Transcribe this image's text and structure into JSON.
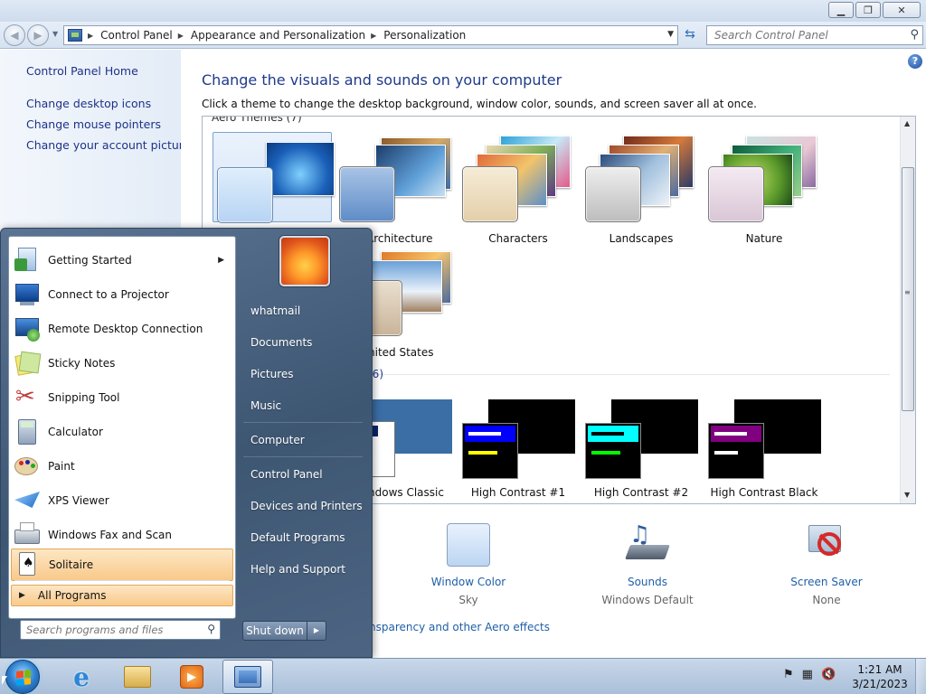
{
  "window": {
    "minimize": "▁",
    "maximize": "❐",
    "close": "✕"
  },
  "address": {
    "crumbs": [
      "Control Panel",
      "Appearance and Personalization",
      "Personalization"
    ],
    "search_placeholder": "Search Control Panel"
  },
  "left_pane": {
    "links": [
      "Control Panel Home",
      "Change desktop icons",
      "Change mouse pointers",
      "Change your account picture"
    ]
  },
  "main": {
    "heading": "Change the visuals and sounds on your computer",
    "subtext": "Click a theme to change the desktop background, window color, sounds, and screen saver all at once.",
    "aero_group_label": "Aero Themes (7)",
    "basic_group_label": "(6)",
    "themes": [
      "Architecture",
      "Characters",
      "Landscapes",
      "Nature",
      "nited States"
    ],
    "basic_themes": [
      "ndows Classic",
      "High Contrast #1",
      "High Contrast #2",
      "High Contrast Black"
    ],
    "settings": [
      {
        "title": "Window Color",
        "subtitle": "Sky"
      },
      {
        "title": "Sounds",
        "subtitle": "Windows Default"
      },
      {
        "title": "Screen Saver",
        "subtitle": "None"
      }
    ],
    "aero_link": "nsparency and other Aero effects"
  },
  "start_menu": {
    "programs": [
      "Getting Started",
      "Connect to a Projector",
      "Remote Desktop Connection",
      "Sticky Notes",
      "Snipping Tool",
      "Calculator",
      "Paint",
      "XPS Viewer",
      "Windows Fax and Scan",
      "Solitaire"
    ],
    "all_programs": "All Programs",
    "search_placeholder": "Search programs and files",
    "right_links": [
      "whatmail",
      "Documents",
      "Pictures",
      "Music",
      "Computer",
      "Control Panel",
      "Devices and Printers",
      "Default Programs",
      "Help and Support"
    ],
    "shutdown": "Shut down"
  },
  "taskbar": {
    "time": "1:21 AM",
    "date": "3/21/2023"
  }
}
